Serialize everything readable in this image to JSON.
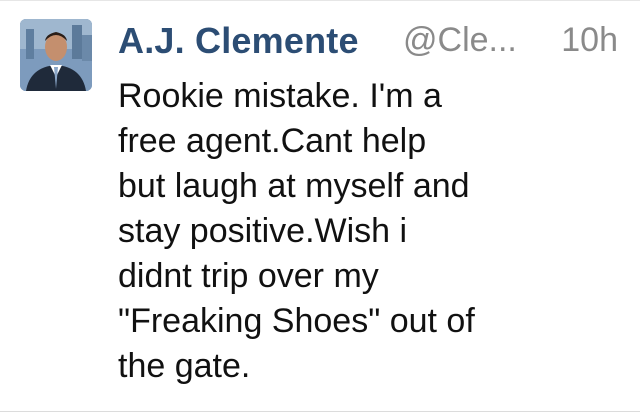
{
  "tweet": {
    "display_name": "A.J. Clemente",
    "handle": "@Cle...",
    "timestamp": "10h",
    "text_lines": [
      "Rookie mistake. I'm a",
      "free agent.Cant help",
      "but laugh at myself and",
      "stay positive.Wish i",
      "didnt trip over my",
      "\"Freaking Shoes\" out of",
      "the gate."
    ]
  },
  "colors": {
    "name": "#2c4d74",
    "meta": "#8a8a8a",
    "text": "#111111"
  }
}
